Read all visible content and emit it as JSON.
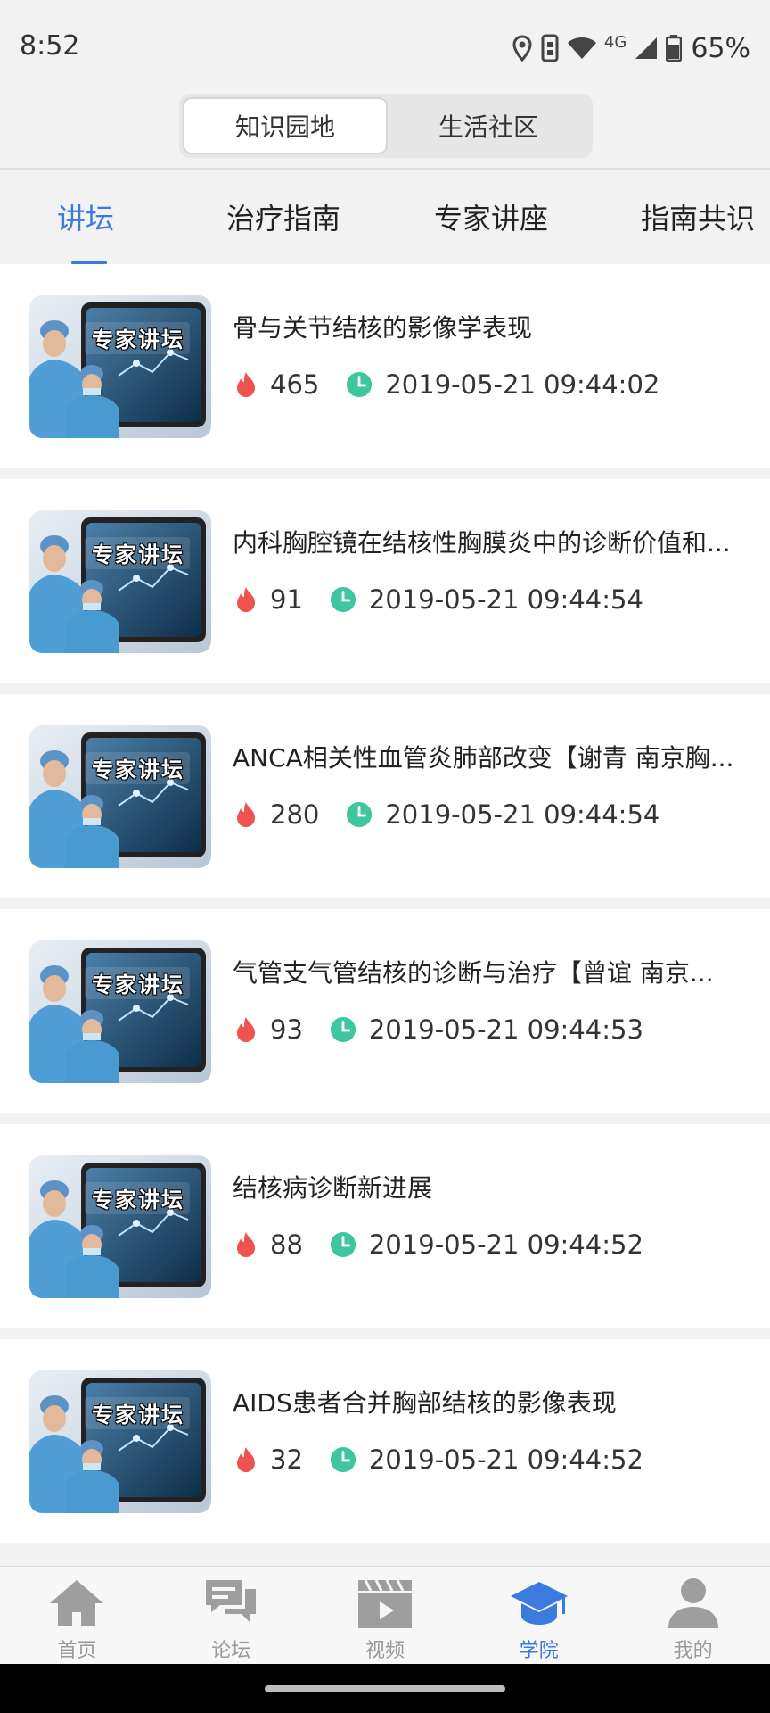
{
  "status_bar": {
    "time": "8:52",
    "network": "4G",
    "battery": "65%"
  },
  "segments": [
    {
      "label": "知识园地",
      "active": true
    },
    {
      "label": "生活社区",
      "active": false
    }
  ],
  "tabs": [
    {
      "label": "讲坛",
      "active": true
    },
    {
      "label": "治疗指南",
      "active": false
    },
    {
      "label": "专家讲座",
      "active": false
    },
    {
      "label": "指南共识",
      "active": false
    }
  ],
  "thumbnail": {
    "banner_text": "专家讲坛"
  },
  "items": [
    {
      "title": "骨与关节结核的影像学表现",
      "views": "465",
      "time": "2019-05-21 09:44:02"
    },
    {
      "title": "内科胸腔镜在结核性胸膜炎中的诊断价值和...",
      "views": "91",
      "time": "2019-05-21 09:44:54"
    },
    {
      "title": "ANCA相关性血管炎肺部改变【谢青 南京胸...",
      "views": "280",
      "time": "2019-05-21 09:44:54"
    },
    {
      "title": "气管支气管结核的诊断与治疗【曾谊 南京...",
      "views": "93",
      "time": "2019-05-21 09:44:53"
    },
    {
      "title": "结核病诊断新进展",
      "views": "88",
      "time": "2019-05-21 09:44:52"
    },
    {
      "title": "AIDS患者合并胸部结核的影像表现",
      "views": "32",
      "time": "2019-05-21 09:44:52"
    }
  ],
  "bottom_nav": [
    {
      "label": "首页",
      "icon": "home-icon",
      "active": false
    },
    {
      "label": "论坛",
      "icon": "chat-icon",
      "active": false
    },
    {
      "label": "视频",
      "icon": "video-icon",
      "active": false
    },
    {
      "label": "学院",
      "icon": "graduation-cap-icon",
      "active": true
    },
    {
      "label": "我的",
      "icon": "person-icon",
      "active": false
    }
  ],
  "colors": {
    "accent": "#3b7be0",
    "fire": "#ef5350",
    "clock": "#3ec6a0",
    "nav_inactive": "#9e9e9e"
  }
}
